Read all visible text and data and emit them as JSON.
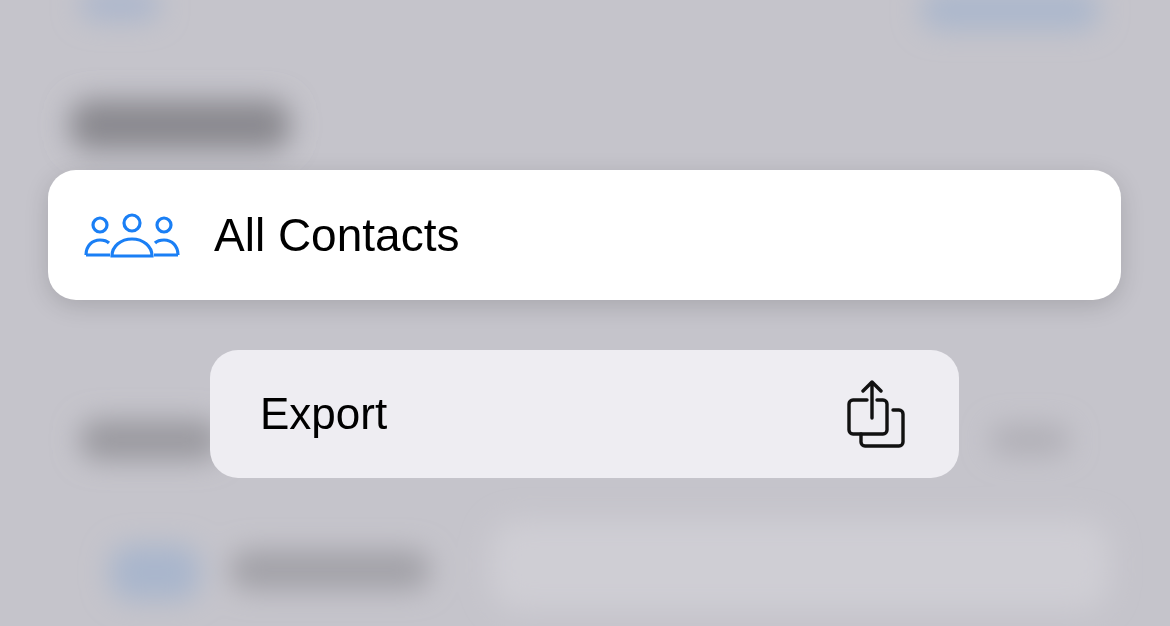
{
  "header": {
    "title": "All Contacts",
    "kind": "group"
  },
  "menu": [
    {
      "label": "Export",
      "kind": "share"
    }
  ]
}
